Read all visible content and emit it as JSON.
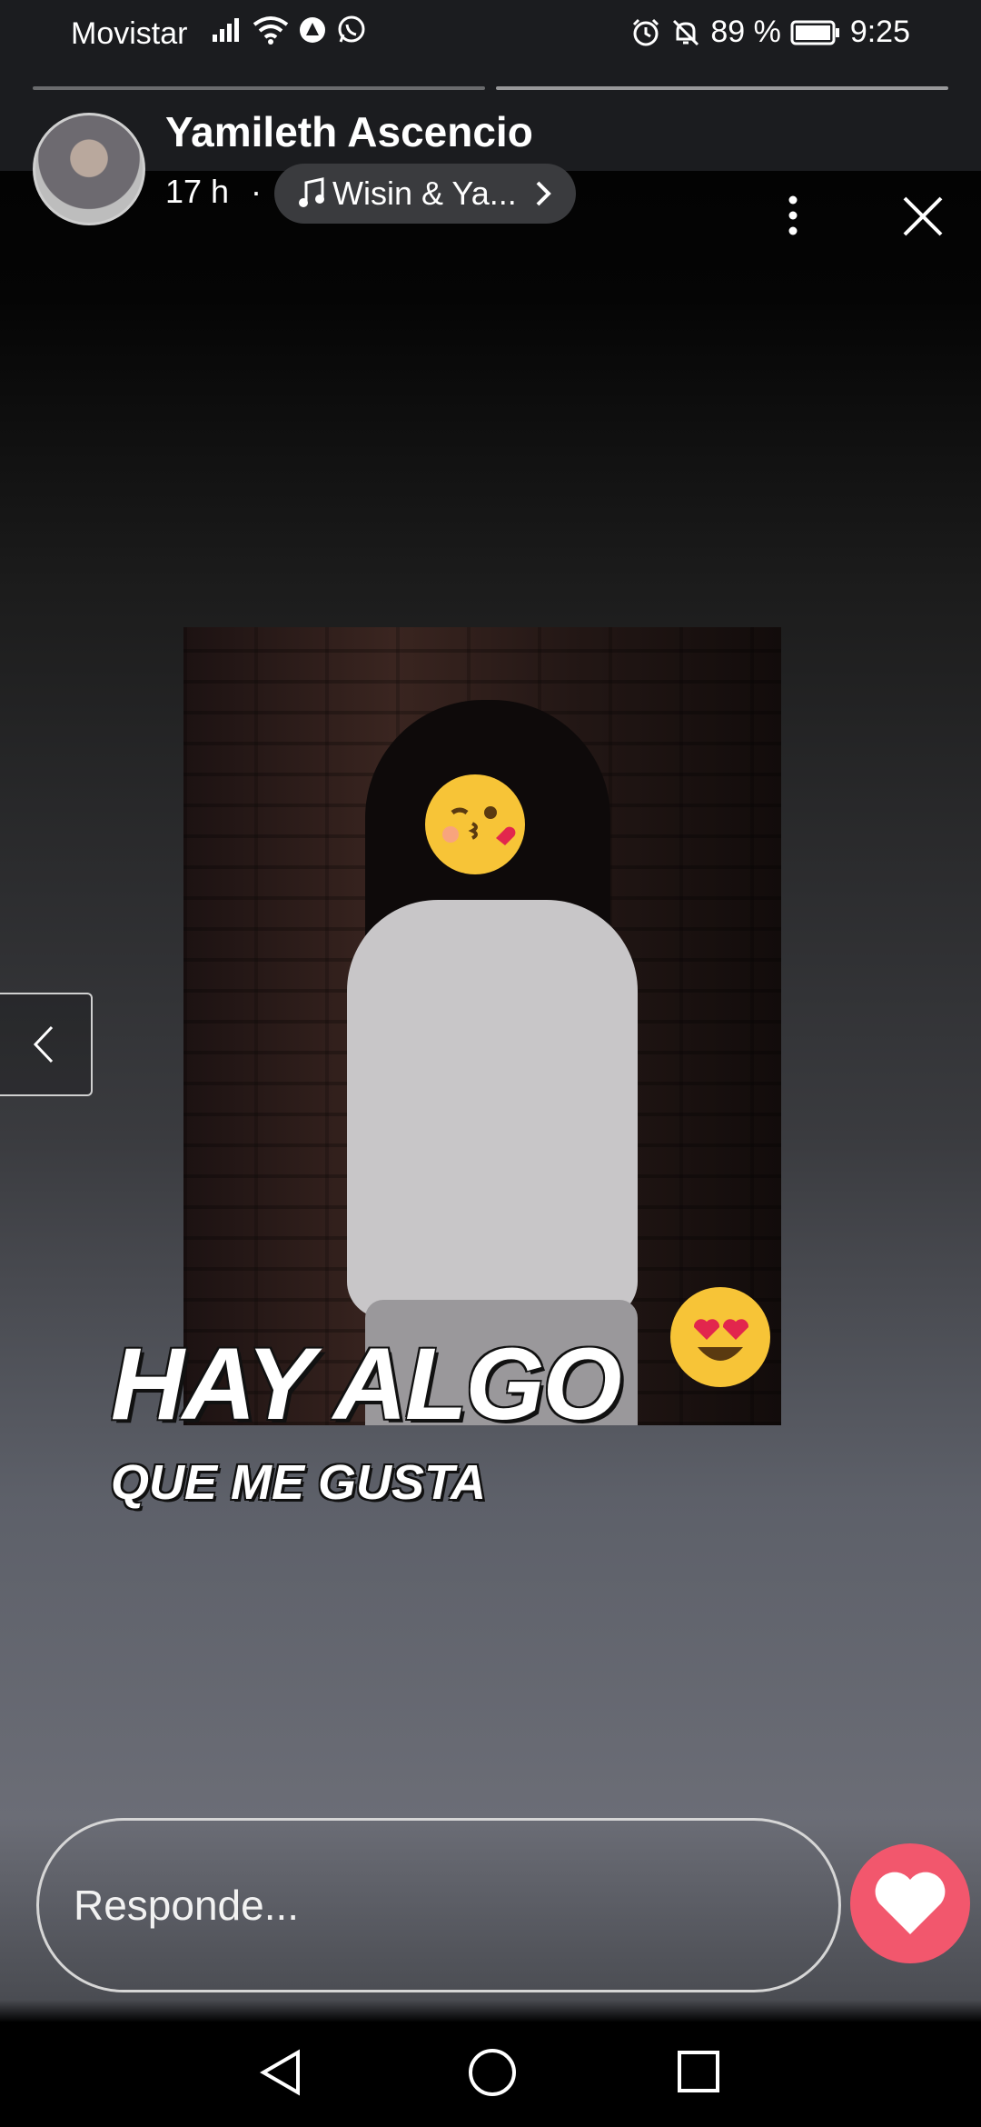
{
  "status_bar": {
    "carrier": "Movistar",
    "battery_percent": "89 %",
    "time": "9:25",
    "icons": [
      "signal-icon",
      "wifi-icon",
      "data-saver-icon",
      "whatsapp-icon",
      "alarm-icon",
      "mute-icon",
      "battery-icon"
    ]
  },
  "story": {
    "user_name": "Yamileth Ascencio",
    "posted_ago": "17 h",
    "separator": "·",
    "music_label": "Wisin & Ya...",
    "segments_total": 2,
    "active_segment": 2
  },
  "media": {
    "caption_line1": "HAY ALGO",
    "caption_line2": "QUE ME GUSTA"
  },
  "reply": {
    "placeholder": "Responde..."
  },
  "colors": {
    "like_button": "#f2576d",
    "status_bar_bg": "#1b1c1f",
    "pill_bg": "#3a3b3e"
  }
}
